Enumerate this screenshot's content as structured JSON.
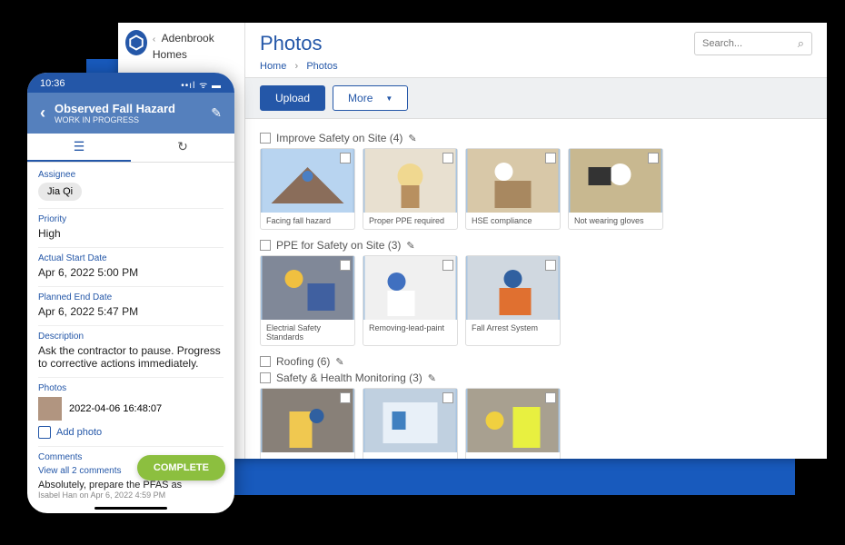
{
  "sidebar": {
    "org_name": "Adenbrook Homes"
  },
  "page": {
    "title": "Photos"
  },
  "breadcrumbs": {
    "home": "Home",
    "current": "Photos"
  },
  "search": {
    "placeholder": "Search..."
  },
  "toolbar": {
    "upload": "Upload",
    "more": "More"
  },
  "sections": [
    {
      "title": "Improve Safety on Site",
      "count": 4,
      "cards": [
        {
          "caption": "Facing fall hazard"
        },
        {
          "caption": "Proper PPE required"
        },
        {
          "caption": "HSE compliance"
        },
        {
          "caption": "Not wearing gloves"
        }
      ]
    },
    {
      "title": "PPE for Safety on Site",
      "count": 3,
      "cards": [
        {
          "caption": "Electrial Safety Standards"
        },
        {
          "caption": "Removing-lead-paint"
        },
        {
          "caption": "Fall Arrest System"
        }
      ]
    },
    {
      "title": "Roofing",
      "count": 6,
      "cards": []
    },
    {
      "title": "Safety & Health Monitoring",
      "count": 3,
      "cards": [
        {
          "caption": ""
        },
        {
          "caption": ""
        },
        {
          "caption": ""
        }
      ]
    }
  ],
  "mobile": {
    "time": "10:36",
    "title": "Observed Fall Hazard",
    "status": "WORK IN PROGRESS",
    "assignee_label": "Assignee",
    "assignee": "Jia Qi",
    "priority_label": "Priority",
    "priority": "High",
    "actual_start_label": "Actual Start Date",
    "actual_start": "Apr 6, 2022 5:00 PM",
    "planned_end_label": "Planned End Date",
    "planned_end": "Apr 6, 2022 5:47 PM",
    "description_label": "Description",
    "description": "Ask the contractor to pause. Progress to corrective actions immediately.",
    "photos_label": "Photos",
    "photo_time": "2022-04-06 16:48:07",
    "add_photo": "Add photo",
    "comments_label": "Comments",
    "view_comments": "View all 2 comments",
    "comment_text": "Absolutely, prepare the PFAS as",
    "comment_meta": "Isabel Han on Apr 6, 2022 4:59 PM",
    "complete": "COMPLETE"
  }
}
